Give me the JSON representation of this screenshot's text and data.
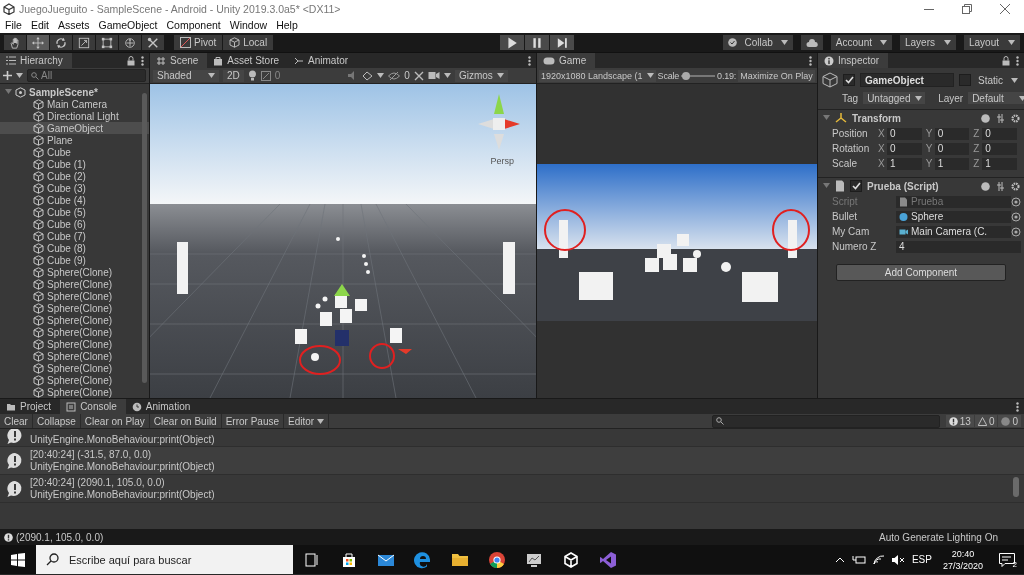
{
  "window": {
    "title": "JuegoJueguito - SampleScene - Android - Unity 2019.3.0a5* <DX11>"
  },
  "menu": [
    "File",
    "Edit",
    "Assets",
    "GameObject",
    "Component",
    "Window",
    "Help"
  ],
  "toolbar": {
    "tools": [
      {
        "kind": "hand",
        "selected": false
      },
      {
        "kind": "move",
        "selected": true
      },
      {
        "kind": "rotate",
        "selected": false
      },
      {
        "kind": "scale",
        "selected": false
      },
      {
        "kind": "rect",
        "selected": false
      },
      {
        "kind": "transform",
        "selected": false
      },
      {
        "kind": "custom",
        "selected": false
      }
    ],
    "pivot": "Pivot",
    "local": "Local",
    "collab": "Collab",
    "account": "Account",
    "layers": "Layers",
    "layout": "Layout"
  },
  "hierarchy": {
    "title": "Hierarchy",
    "search": {
      "placeholder": "All"
    },
    "scene": {
      "name": "SampleScene*",
      "expanded": true,
      "children": [
        {
          "label": "Main Camera",
          "selected": false
        },
        {
          "label": "Directional Light",
          "selected": false
        },
        {
          "label": "GameObject",
          "selected": true
        },
        {
          "label": "Plane",
          "selected": false
        },
        {
          "label": "Cube",
          "selected": false
        },
        {
          "label": "Cube (1)",
          "selected": false
        },
        {
          "label": "Cube (2)",
          "selected": false
        },
        {
          "label": "Cube (3)",
          "selected": false
        },
        {
          "label": "Cube (4)",
          "selected": false
        },
        {
          "label": "Cube (5)",
          "selected": false
        },
        {
          "label": "Cube (6)",
          "selected": false
        },
        {
          "label": "Cube (7)",
          "selected": false
        },
        {
          "label": "Cube (8)",
          "selected": false
        },
        {
          "label": "Cube (9)",
          "selected": false
        },
        {
          "label": "Sphere(Clone)",
          "selected": false
        },
        {
          "label": "Sphere(Clone)",
          "selected": false
        },
        {
          "label": "Sphere(Clone)",
          "selected": false
        },
        {
          "label": "Sphere(Clone)",
          "selected": false
        },
        {
          "label": "Sphere(Clone)",
          "selected": false
        },
        {
          "label": "Sphere(Clone)",
          "selected": false
        },
        {
          "label": "Sphere(Clone)",
          "selected": false
        },
        {
          "label": "Sphere(Clone)",
          "selected": false
        },
        {
          "label": "Sphere(Clone)",
          "selected": false
        },
        {
          "label": "Sphere(Clone)",
          "selected": false
        },
        {
          "label": "Sphere(Clone)",
          "selected": false
        }
      ]
    }
  },
  "scene_view": {
    "tabs": [
      {
        "label": "Scene",
        "kind": "grid",
        "selected": true
      },
      {
        "label": "Asset Store",
        "kind": "bag",
        "selected": false
      },
      {
        "label": "Animator",
        "kind": "animator",
        "selected": false
      }
    ],
    "shading": "Shaded",
    "mode_2d": "2D",
    "effects_count": "0",
    "hidden_count": "0",
    "gizmos": "Gizmos",
    "projection": "Persp"
  },
  "game_view": {
    "tab": "Game",
    "resolution": "1920x1080 Landscape (1",
    "scale_label": "Scale",
    "scale": {
      "level": 0.15
    },
    "scale_value": "0.19:",
    "maximize": "Maximize On Play"
  },
  "inspector": {
    "title": "Inspector",
    "object": {
      "active": true,
      "name": "GameObject",
      "static": false,
      "static_label": "Static",
      "tag_label": "Tag",
      "tag": "Untagged",
      "layer_label": "Layer",
      "layer": "Default"
    },
    "components": [
      {
        "kind": "transform",
        "title": "Transform",
        "expanded": true,
        "rows": [
          {
            "label": "Position",
            "values": [
              {
                "axis": "X",
                "value": "0"
              },
              {
                "axis": "Y",
                "value": "0"
              },
              {
                "axis": "Z",
                "value": "0"
              }
            ]
          },
          {
            "label": "Rotation",
            "values": [
              {
                "axis": "X",
                "value": "0"
              },
              {
                "axis": "Y",
                "value": "0"
              },
              {
                "axis": "Z",
                "value": "0"
              }
            ]
          },
          {
            "label": "Scale",
            "values": [
              {
                "axis": "X",
                "value": "1"
              },
              {
                "axis": "Y",
                "value": "1"
              },
              {
                "axis": "Z",
                "value": "1"
              }
            ]
          }
        ]
      },
      {
        "kind": "script",
        "title": "Prueba (Script)",
        "expanded": true,
        "enabled": true,
        "fields": [
          {
            "label": "Script",
            "value": "Prueba",
            "kind": "script",
            "disabled": true
          },
          {
            "label": "Bullet",
            "value": "Sphere",
            "kind": "prefab",
            "disabled": false
          },
          {
            "label": "My Cam",
            "value": "Main Camera (C.",
            "kind": "camera",
            "disabled": false
          },
          {
            "label": "Numero Z",
            "value": "4",
            "kind": "number",
            "disabled": false
          }
        ]
      }
    ],
    "add_component": "Add Component"
  },
  "bottom": {
    "tabs": [
      {
        "label": "Project",
        "kind": "folder",
        "selected": false
      },
      {
        "label": "Console",
        "kind": "console",
        "selected": true
      },
      {
        "label": "Animation",
        "kind": "clock",
        "selected": false
      }
    ],
    "console": {
      "buttons": [
        "Clear",
        "Collapse",
        "Clear on Play",
        "Clear on Build",
        "Error Pause"
      ],
      "editor": "Editor",
      "counts": {
        "info": "13",
        "warnings": "0",
        "errors": "0"
      },
      "entries": [
        {
          "detail": "UnityEngine.MonoBehaviour:print(Object)"
        },
        {
          "message": "[20:40:24] (-31.5, 87.0, 0.0)",
          "detail": "UnityEngine.MonoBehaviour:print(Object)"
        },
        {
          "message": "[20:40:24] (2090.1, 105.0, 0.0)",
          "detail": "UnityEngine.MonoBehaviour:print(Object)"
        }
      ]
    }
  },
  "status_bar": {
    "message": "(2090.1, 105.0, 0.0)",
    "lighting": "Auto Generate Lighting On"
  },
  "taskbar": {
    "search": {
      "placeholder": "Escribe aquí para buscar"
    },
    "language": "ESP",
    "time": "20:40",
    "date": "27/3/2020",
    "notifications": "2"
  }
}
